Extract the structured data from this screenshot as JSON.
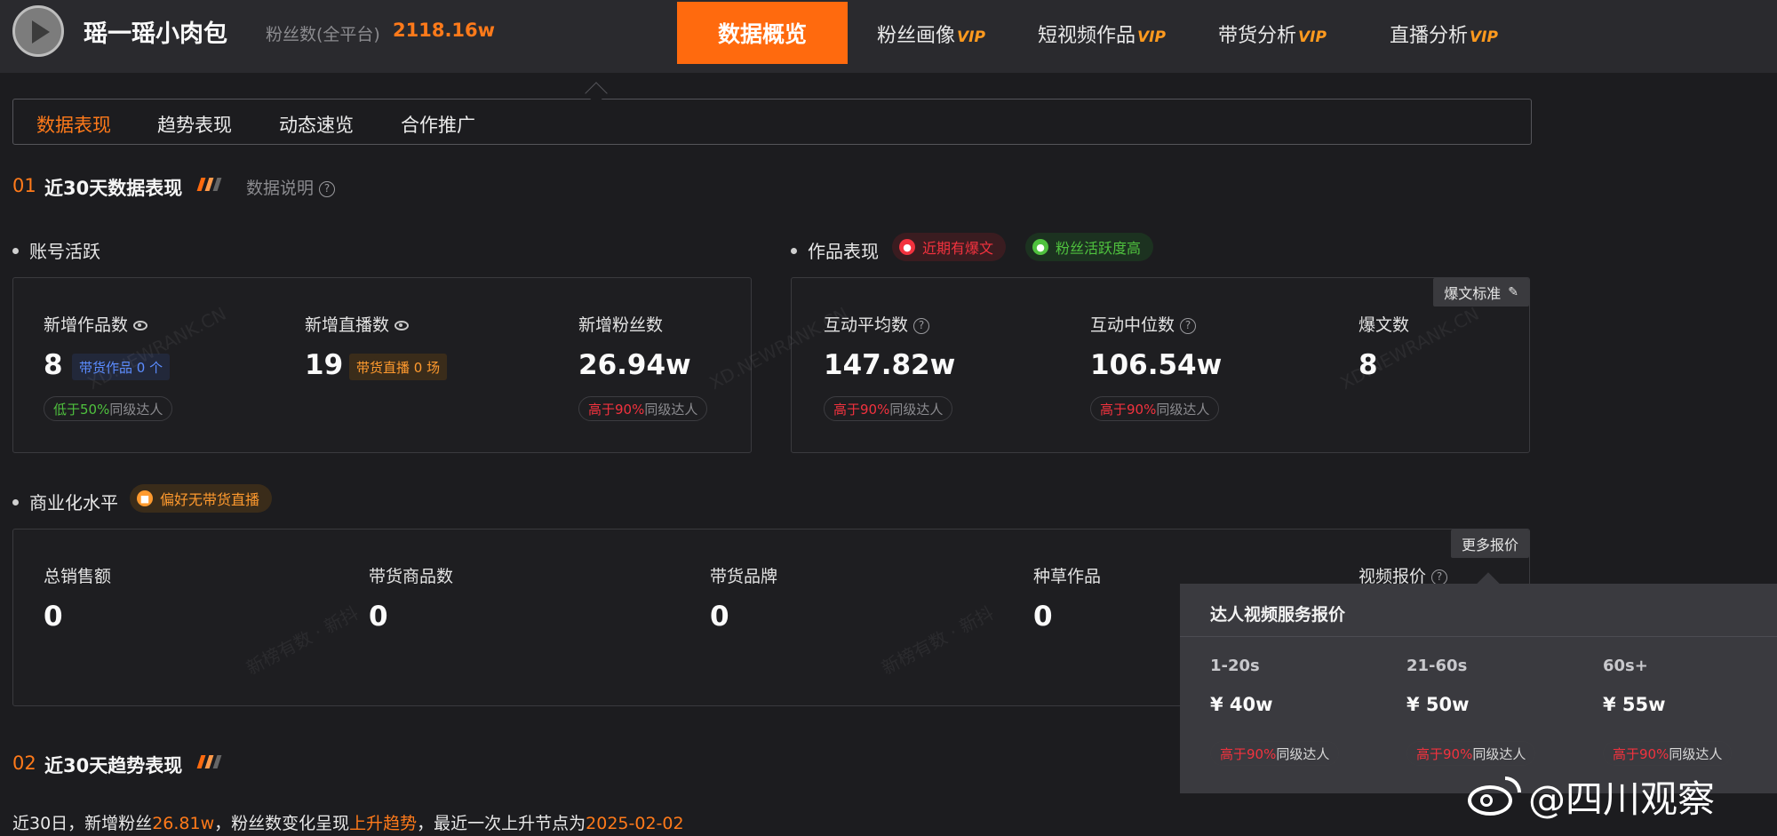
{
  "header": {
    "account_name": "瑶一瑶小肉包",
    "fans_label": "粉丝数(全平台)",
    "fans_value": "2118.16w",
    "nav_active": "数据概览",
    "nav_items": [
      {
        "label": "粉丝画像",
        "vip": "VIP"
      },
      {
        "label": "短视频作品",
        "vip": "VIP"
      },
      {
        "label": "带货分析",
        "vip": "VIP"
      },
      {
        "label": "直播分析",
        "vip": "VIP"
      }
    ]
  },
  "subtabs": [
    "数据表现",
    "趋势表现",
    "动态速览",
    "合作推广"
  ],
  "section1": {
    "num": "01",
    "title": "近30天数据表现",
    "explain": "数据说明"
  },
  "account": {
    "title": "账号活跃",
    "metrics": [
      {
        "label": "新增作品数",
        "value": "8",
        "chip": "带货作品 0 个",
        "cmp_prefix": "低于50%",
        "cmp_suffix": "同级达人"
      },
      {
        "label": "新增直播数",
        "value": "19",
        "chip": "带货直播 0 场"
      },
      {
        "label": "新增粉丝数",
        "value": "26.94w",
        "cmp_prefix": "高于90%",
        "cmp_suffix": "同级达人"
      }
    ]
  },
  "works": {
    "title": "作品表现",
    "tag1": "近期有爆文",
    "tag2": "粉丝活跃度高",
    "corner": "爆文标准",
    "metrics": [
      {
        "label": "互动平均数",
        "value": "147.82w",
        "cmp_prefix": "高于90%",
        "cmp_suffix": "同级达人"
      },
      {
        "label": "互动中位数",
        "value": "106.54w",
        "cmp_prefix": "高于90%",
        "cmp_suffix": "同级达人"
      },
      {
        "label": "爆文数",
        "value": "8"
      }
    ]
  },
  "commerce": {
    "title": "商业化水平",
    "tag": "偏好无带货直播",
    "corner": "更多报价",
    "metrics": [
      {
        "label": "总销售额",
        "value": "0"
      },
      {
        "label": "带货商品数",
        "value": "0"
      },
      {
        "label": "带货品牌",
        "value": "0"
      },
      {
        "label": "种草作品",
        "value": "0"
      },
      {
        "label": "视频报价"
      }
    ]
  },
  "popover": {
    "title": "达人视频服务报价",
    "columns": [
      {
        "range": "1-20s",
        "price": "¥ 40w",
        "cmp_prefix": "高于90%",
        "cmp_suffix": "同级达人"
      },
      {
        "range": "21-60s",
        "price": "¥ 50w",
        "cmp_prefix": "高于90%",
        "cmp_suffix": "同级达人"
      },
      {
        "range": "60s+",
        "price": "¥ 55w",
        "cmp_prefix": "高于90%",
        "cmp_suffix": "同级达人"
      }
    ]
  },
  "section2": {
    "num": "02",
    "title": "近30天趋势表现"
  },
  "summary": {
    "p1": "近30日，新增粉丝",
    "v1": "26.81w",
    "p2": "，粉丝数变化呈现",
    "v2": "上升趋势",
    "p3": "，最近一次上升节点为",
    "v3": "2025-02-02"
  },
  "watermarks": {
    "brand": "XD.NEWRANK.CN",
    "cn": "新榜有数 · 新抖"
  },
  "overlay": {
    "weibo_handle": "@四川观察"
  }
}
